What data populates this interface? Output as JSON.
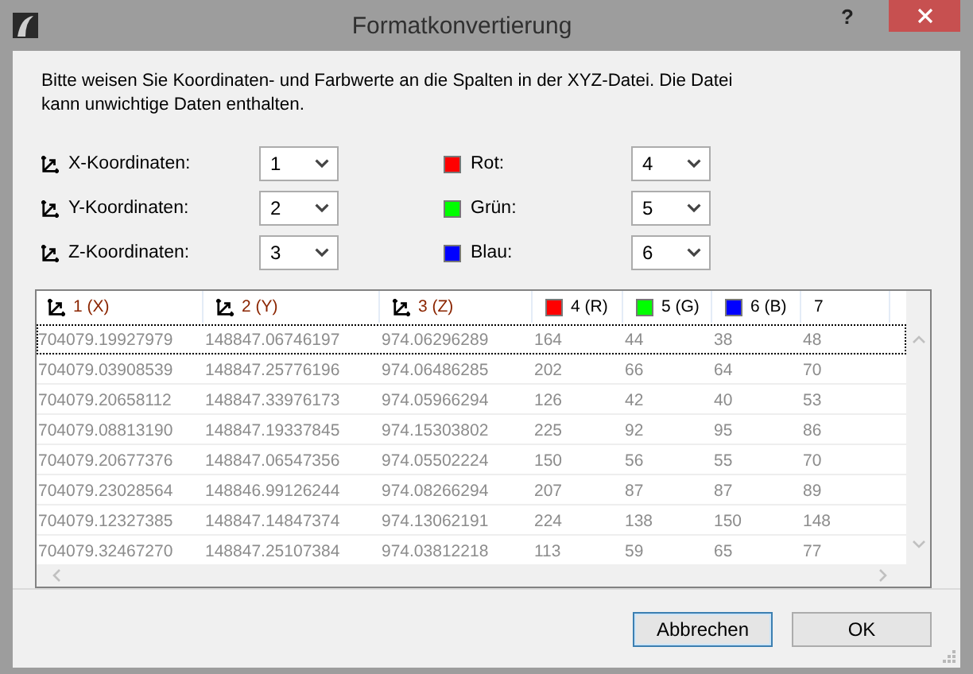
{
  "window": {
    "title": "Formatkonvertierung",
    "help": "?"
  },
  "intro": "Bitte weisen Sie Koordinaten- und Farbwerte an die Spalten in der XYZ-Datei. Die Datei kann unwichtige Daten enthalten.",
  "mappings": [
    {
      "kind": "axis",
      "label": "X-Koordinaten:",
      "value": "1"
    },
    {
      "kind": "color",
      "color": "#ff0000",
      "label": "Rot:",
      "value": "4"
    },
    {
      "kind": "axis",
      "label": "Y-Koordinaten:",
      "value": "2"
    },
    {
      "kind": "color",
      "color": "#00ff00",
      "label": "Grün:",
      "value": "5"
    },
    {
      "kind": "axis",
      "label": "Z-Koordinaten:",
      "value": "3"
    },
    {
      "kind": "color",
      "color": "#0000ff",
      "label": "Blau:",
      "value": "6"
    }
  ],
  "table": {
    "columns": [
      {
        "kind": "axis",
        "number": "1",
        "tag": "(X)"
      },
      {
        "kind": "axis",
        "number": "2",
        "tag": "(Y)"
      },
      {
        "kind": "axis",
        "number": "3",
        "tag": "(Z)"
      },
      {
        "kind": "color",
        "color": "#ff0000",
        "number": "4",
        "tag": "(R)"
      },
      {
        "kind": "color",
        "color": "#00ff00",
        "number": "5",
        "tag": "(G)"
      },
      {
        "kind": "color",
        "color": "#0000ff",
        "number": "6",
        "tag": "(B)"
      },
      {
        "kind": "plain",
        "number": "7"
      }
    ],
    "rows": [
      {
        "focused": true,
        "cells": [
          "704079.19927979",
          "148847.06746197",
          "974.06296289",
          "164",
          "44",
          "38",
          "48"
        ]
      },
      {
        "focused": false,
        "cells": [
          "704079.03908539",
          "148847.25776196",
          "974.06486285",
          "202",
          "66",
          "64",
          "70"
        ]
      },
      {
        "focused": false,
        "cells": [
          "704079.20658112",
          "148847.33976173",
          "974.05966294",
          "126",
          "42",
          "40",
          "53"
        ]
      },
      {
        "focused": false,
        "cells": [
          "704079.08813190",
          "148847.19337845",
          "974.15303802",
          "225",
          "92",
          "95",
          "86"
        ]
      },
      {
        "focused": false,
        "cells": [
          "704079.20677376",
          "148847.06547356",
          "974.05502224",
          "150",
          "56",
          "55",
          "70"
        ]
      },
      {
        "focused": false,
        "cells": [
          "704079.23028564",
          "148846.99126244",
          "974.08266294",
          "207",
          "87",
          "87",
          "89"
        ]
      },
      {
        "focused": false,
        "cells": [
          "704079.12327385",
          "148847.14847374",
          "974.13062191",
          "224",
          "138",
          "150",
          "148"
        ]
      },
      {
        "focused": false,
        "cells": [
          "704079.32467270",
          "148847.25107384",
          "974.03812218",
          "113",
          "59",
          "65",
          "77"
        ]
      }
    ]
  },
  "buttons": [
    {
      "label": "Abbrechen",
      "default": true
    },
    {
      "label": "OK",
      "default": false
    }
  ]
}
